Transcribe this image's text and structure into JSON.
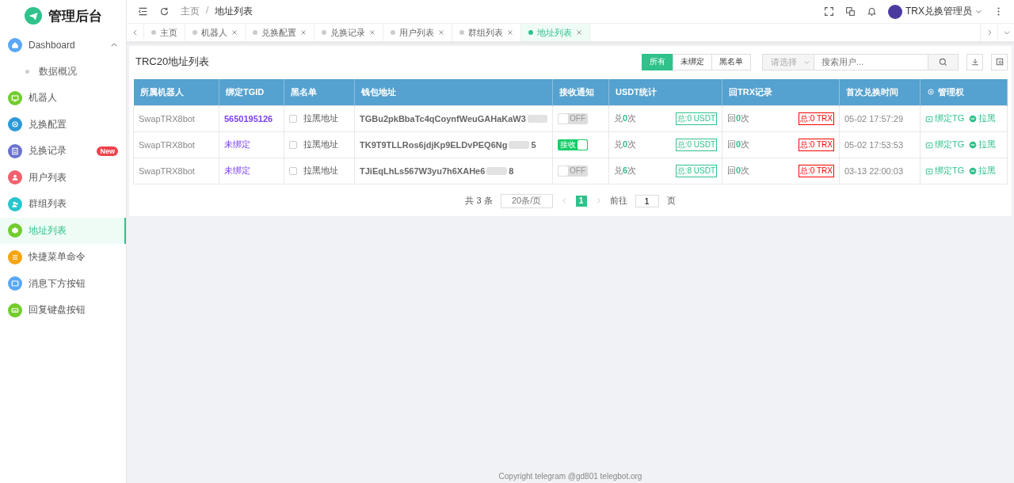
{
  "sidebar": {
    "logo": "管理后台",
    "items": [
      {
        "label": "Dashboard",
        "color": "#5aa7f5",
        "selected": false,
        "expanded": true,
        "children": [
          {
            "label": "数据概况",
            "selected": false
          }
        ]
      },
      {
        "label": "机器人",
        "color": "#73cc2e",
        "selected": false
      },
      {
        "label": "兑换配置",
        "color": "#2d9ad8",
        "selected": false
      },
      {
        "label": "兑换记录",
        "color": "#6b72d0",
        "selected": false,
        "badge": "New"
      },
      {
        "label": "用户列表",
        "color": "#f0616d",
        "selected": false
      },
      {
        "label": "群组列表",
        "color": "#26c6ce",
        "selected": false
      },
      {
        "label": "地址列表",
        "color": "#73cc2e",
        "selected": true
      },
      {
        "label": "快捷菜单命令",
        "color": "#f5a510",
        "selected": false
      },
      {
        "label": "消息下方按钮",
        "color": "#5aa7f5",
        "selected": false
      },
      {
        "label": "回复键盘按钮",
        "color": "#73cc2e",
        "selected": false
      }
    ]
  },
  "header": {
    "breadcrumb": [
      "主页",
      "地址列表"
    ],
    "breadcrumb_separator": "/",
    "user": "TRX兑换管理员"
  },
  "tabs": [
    {
      "label": "主页",
      "selected": false,
      "closable": false
    },
    {
      "label": "机器人",
      "selected": false,
      "closable": true
    },
    {
      "label": "兑换配置",
      "selected": false,
      "closable": true
    },
    {
      "label": "兑换记录",
      "selected": false,
      "closable": true
    },
    {
      "label": "用户列表",
      "selected": false,
      "closable": true
    },
    {
      "label": "群组列表",
      "selected": false,
      "closable": true
    },
    {
      "label": "地址列表",
      "selected": true,
      "closable": true
    }
  ],
  "card": {
    "title": "TRC20地址列表",
    "filters": [
      {
        "label": "所有",
        "selected": true
      },
      {
        "label": "未绑定",
        "selected": false
      },
      {
        "label": "黑名单",
        "selected": false
      }
    ],
    "select": {
      "placeholder": "请选择"
    },
    "search": {
      "placeholder": "搜索用户..."
    },
    "table": {
      "columns": [
        "所属机器人",
        "绑定TGID",
        "黑名单",
        "钱包地址",
        "接收通知",
        "USDT统计",
        "回TRX记录",
        "首次兑换时间",
        "管理权"
      ],
      "rows": [
        {
          "bot": "SwapTRX8bot",
          "tgid": "5650195126",
          "bound": true,
          "blacklisted": false,
          "blacklist_label": "拉黑地址",
          "address": "TGBu2pkBbaTc4qCoynfWeuGAHaKaW3",
          "address_tail": "",
          "notify_on": false,
          "notify_label": "OFF",
          "usdt_count": "兑**0**次",
          "usdt_total": "总:0 USDT",
          "trx_count": "回**0**次",
          "trx_total": "总:0 TRX",
          "time": "05-02 17:57:29",
          "actions": [
            "绑定TG",
            "拉黑"
          ]
        },
        {
          "bot": "SwapTRX8bot",
          "tgid": "未绑定",
          "bound": false,
          "blacklisted": false,
          "blacklist_label": "拉黑地址",
          "address": "TK9T9TLLRos6jdjKp9ELDvPEQ6Ng",
          "address_tail": "5",
          "notify_on": true,
          "notify_label": "接收",
          "usdt_count": "兑**0**次",
          "usdt_total": "总:0 USDT",
          "trx_count": "回**0**次",
          "trx_total": "总:0 TRX",
          "time": "05-02 17:53:53",
          "actions": [
            "绑定TG",
            "拉黑"
          ]
        },
        {
          "bot": "SwapTRX8bot",
          "tgid": "未绑定",
          "bound": false,
          "blacklisted": false,
          "blacklist_label": "拉黑地址",
          "address": "TJiEqLhLs567W3yu7h6XAHe6",
          "address_tail": "8",
          "notify_on": false,
          "notify_label": "OFF",
          "usdt_count": "兑**6**次",
          "usdt_total": "总:8 USDT",
          "trx_count": "回**0**次",
          "trx_total": "总:0 TRX",
          "time": "03-13 22:00:03",
          "actions": [
            "绑定TG",
            "拉黑"
          ]
        }
      ]
    },
    "pagination": {
      "total": "共 3 条",
      "page_size": "20条/页",
      "pages": [
        {
          "label": "1",
          "selected": true
        }
      ],
      "goto": "前往",
      "goto_value": "1",
      "goto_suffix": "页"
    }
  },
  "footer": "Copyright telegram @gd801 telegbot.org"
}
